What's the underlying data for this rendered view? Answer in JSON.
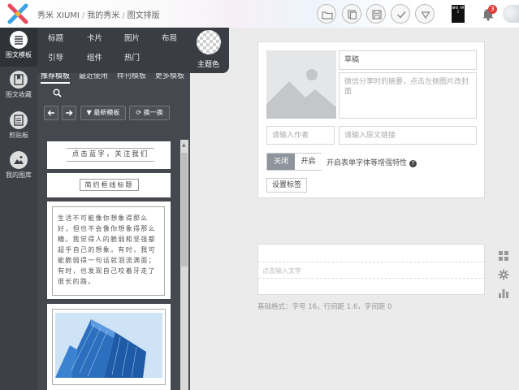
{
  "header": {
    "brand": "秀米 XIUMI",
    "breadcrumb": [
      "我的秀米",
      "图文排版"
    ],
    "toolbar_icons": [
      "folder-icon",
      "copy-icon",
      "save-icon",
      "check-icon",
      "download-icon"
    ],
    "qr_label": "WHO AM I",
    "notification_count": "3"
  },
  "sidebar": {
    "items": [
      {
        "label": "图文模板",
        "icon": "list-icon"
      },
      {
        "label": "图文收藏",
        "icon": "bookmark-icon"
      },
      {
        "label": "剪贴板",
        "icon": "clipboard-icon"
      },
      {
        "label": "我的图库",
        "icon": "image-icon"
      }
    ]
  },
  "categories": {
    "row1": [
      "标题",
      "卡片",
      "图片",
      "布局"
    ],
    "row2": [
      "引导",
      "组件",
      "热门"
    ],
    "theme_label": "主题色"
  },
  "templates": {
    "tabs": [
      "推荐模板",
      "最近使用",
      "样刊模板",
      "更多模板"
    ],
    "buttons": {
      "filter": "最新模板",
      "refresh": "换一换"
    },
    "cards": [
      {
        "text": "点击蓝字，关注我们"
      },
      {
        "text": "简约框线标题"
      },
      {
        "text": "生活不可能像你想象得那么好，但也不会像你想象得那么糟。我觉得人的脆弱和坚强都超乎自己的想象。有时，我可能脆弱得一句话就泪流满面；有时，也发现自己咬着牙走了很长的路。"
      },
      {
        "text": ""
      }
    ]
  },
  "editor": {
    "title_value": "草稿",
    "summary_placeholder": "微信分享时的摘要，点击左侧图片改封面",
    "author_placeholder": "请输入作者",
    "link_placeholder": "请输入原文链接",
    "toggle_off": "关闭",
    "toggle_on": "开启",
    "toggle_note": "开启表单字体等增强特性",
    "settings_button": "设置标签",
    "content_placeholder": "点击输入文字",
    "format_info": "基础格式：字号 16，行间距 1.6，字间距 0"
  },
  "colors": {
    "sidebar_bg": "#3d4046",
    "panel_bg": "#45494f",
    "badge": "#e23c3c"
  }
}
